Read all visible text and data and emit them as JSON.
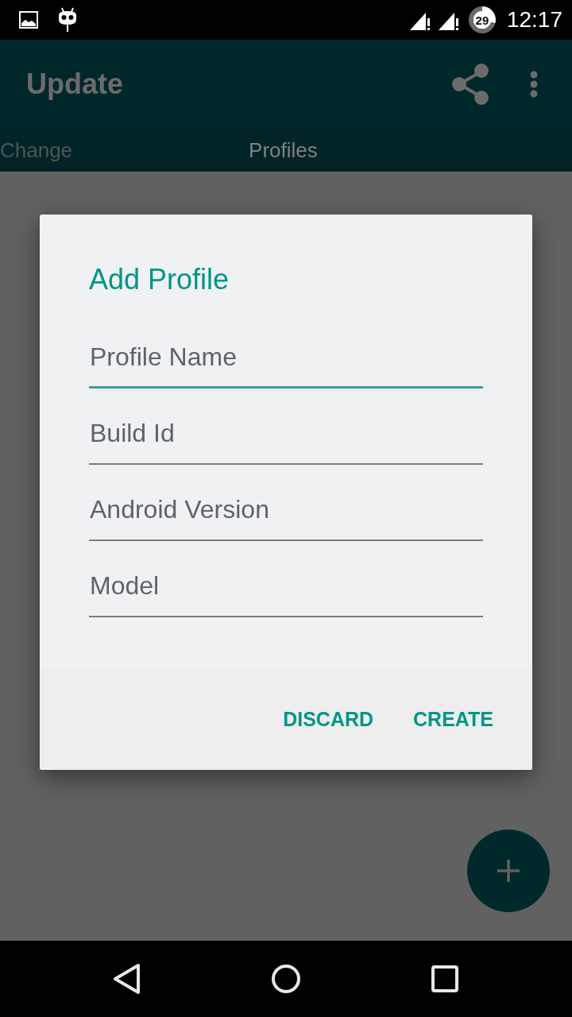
{
  "status_bar": {
    "battery": "29",
    "time": "12:17"
  },
  "app_bar": {
    "title": "Update"
  },
  "tabs": [
    {
      "label": "Change",
      "selected": false
    },
    {
      "label": "Profiles",
      "selected": true
    }
  ],
  "dialog": {
    "title": "Add Profile",
    "fields": [
      {
        "placeholder": "Profile Name",
        "focused": true
      },
      {
        "placeholder": "Build Id",
        "focused": false
      },
      {
        "placeholder": "Android Version",
        "focused": false
      },
      {
        "placeholder": "Model",
        "focused": false
      }
    ],
    "buttons": [
      "DISCARD",
      "CREATE"
    ]
  }
}
